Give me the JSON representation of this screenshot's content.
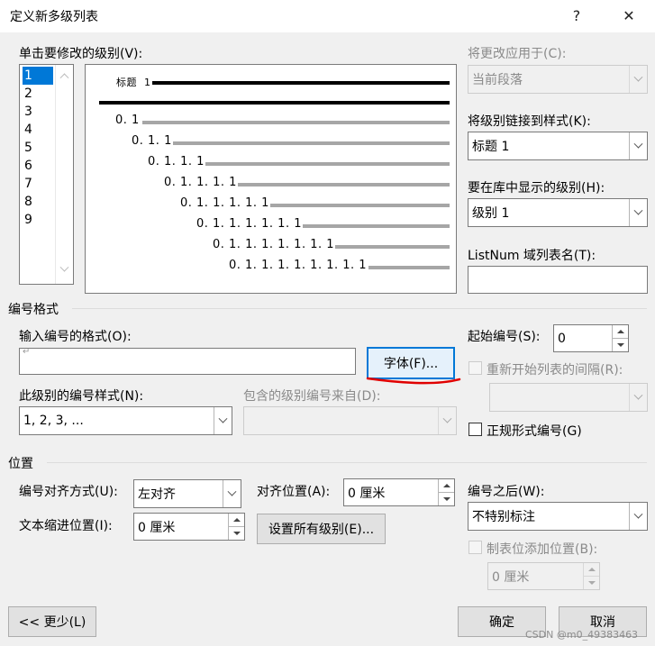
{
  "dialog": {
    "title": "定义新多级列表",
    "help_glyph": "?",
    "close_glyph": "✕"
  },
  "levels": {
    "label": "单击要修改的级别(V):",
    "items": [
      "1",
      "2",
      "3",
      "4",
      "5",
      "6",
      "7",
      "8",
      "9"
    ],
    "selected": "1"
  },
  "preview": {
    "heading_label": "标题",
    "heading_num": "1",
    "lines": [
      "0. 1",
      "0. 1. 1",
      "0. 1. 1. 1",
      "0. 1. 1. 1. 1",
      "0. 1. 1. 1. 1. 1",
      "0. 1. 1. 1. 1. 1. 1",
      "0. 1. 1. 1. 1. 1. 1. 1",
      "0. 1. 1. 1. 1. 1. 1. 1. 1"
    ]
  },
  "right_panel": {
    "apply_to_label": "将更改应用于(C):",
    "apply_to_value": "当前段落",
    "link_style_label": "将级别链接到样式(K):",
    "link_style_value": "标题 1",
    "gallery_level_label": "要在库中显示的级别(H):",
    "gallery_level_value": "级别 1",
    "listnum_label": "ListNum 域列表名(T):",
    "listnum_value": ""
  },
  "number_format": {
    "section_label": "编号格式",
    "enter_format_label": "输入编号的格式(O):",
    "format_value": "",
    "font_button": "字体(F)...",
    "style_label": "此级别的编号样式(N):",
    "style_value": "1, 2, 3, ...",
    "include_from_label": "包含的级别编号来自(D):",
    "include_from_value": "",
    "start_at_label": "起始编号(S):",
    "start_at_value": "0",
    "restart_label": "重新开始列表的间隔(R):",
    "restart_value": "",
    "legal_label": "正规形式编号(G)"
  },
  "position": {
    "section_label": "位置",
    "alignment_label": "编号对齐方式(U):",
    "alignment_value": "左对齐",
    "aligned_at_label": "对齐位置(A):",
    "aligned_at_value": "0 厘米",
    "indent_label": "文本缩进位置(I):",
    "indent_value": "0 厘米",
    "set_all_button": "设置所有级别(E)...",
    "follow_label": "编号之后(W):",
    "follow_value": "不特别标注",
    "tab_stop_label": "制表位添加位置(B):",
    "tab_stop_value": "0 厘米"
  },
  "footer": {
    "less_button": "<< 更少(L)",
    "ok_button": "确定",
    "cancel_button": "取消",
    "watermark": "CSDN @m0_49383463"
  },
  "colors": {
    "selection": "#0078d7",
    "annotation": "#e00000"
  }
}
